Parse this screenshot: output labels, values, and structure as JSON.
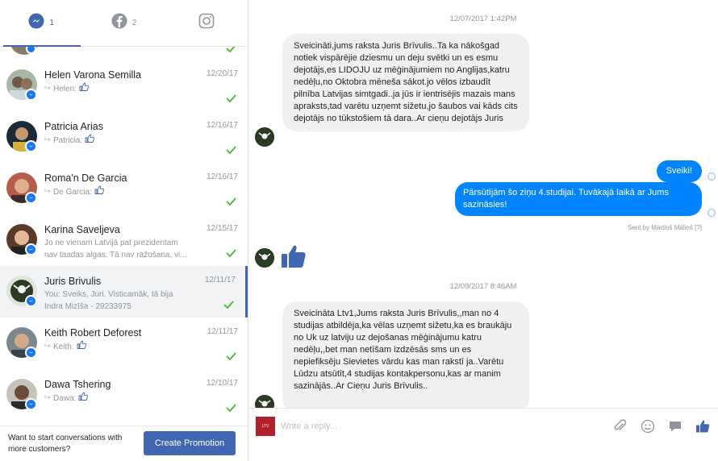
{
  "tabs": {
    "messenger_count": "1",
    "facebook_count": "2"
  },
  "conversations": [
    {
      "name": "Helen Varona Semilla",
      "date": "12/20/17",
      "snippet": "Helen:"
    },
    {
      "name": "Patricia Arias",
      "date": "12/16/17",
      "snippet": "Patricia:"
    },
    {
      "name": "Roma'n De Garcia",
      "date": "12/16/17",
      "snippet": "De Garcia:"
    },
    {
      "name": "Karina Saveljeva",
      "date": "12/15/17",
      "snippet_line1": "Jo ne vienam Latvijā pat prezidentam",
      "snippet_line2": "nav taadas algas. Tā nav ražošana, vi..."
    },
    {
      "name": "Juris Brivulis",
      "date": "12/11/17",
      "snippet_line1": "You: Sveiks, Juri. Visticamāk, tā bija",
      "snippet_line2": "Indra Mizīša - 29233975"
    },
    {
      "name": "Keith Robert Deforest",
      "date": "12/11/17",
      "snippet": "Keith:"
    },
    {
      "name": "Dawa Tshering",
      "date": "12/10/17",
      "snippet": "Dawa:"
    }
  ],
  "promo": {
    "text": "Want to start conversations with more customers?",
    "button": "Create Promotion"
  },
  "thread": {
    "timestamp1": "12/07/2017 1:42PM",
    "message1": "Sveicināti,jums raksta Juris Brīvulis..Ta ka nākošgad notiek vispārējie dziesmu un deju svētki un es esmu dejotājs,es LIDOJU uz mēģinājumiem no Anglijas,katru nedēļu,no Oktobra mēneša sākot.jo vēlos izbaudīt pilnība Latvijas simtgadi..ja jūs ir ientrisējis mazais mans apraksts,tad varētu uzņemt sižetu,jo šaubos vai kāds cits dejotājs no tūkstošiem tā dara..Ar cieņu dejotājs Juris",
    "reply1": "Sveiki!",
    "reply2": "Pārsūtījām šo ziņu 4.studijai. Tuvākajā laikā ar Jums sazināsies!",
    "sent_by": "Sent by Mārtiņš Māliņš [?]",
    "timestamp2": "12/09/2017 8:46AM",
    "message2": "Sveicināta Ltv1,Jums raksta Juris Brīvulis,,man no 4 studijas atbildēja,ka vēlas uzņemt sižetu,ka es braukāju no Uk uz latviju uz dejošanas mēģinājumu katru nedēļu,,bet man netīšam izdzēsās sms un es nepiefiksēju Sievietes vārdu kas man rakstī ja..Varētu Lūdzu atsūtīt,4 studijas kontakpersonu,kas ar manim sazinājās..Ar Cieņu Juris Brīvulis.."
  },
  "composer": {
    "placeholder": "Write a reply...",
    "page_label": "LTV"
  },
  "colors": {
    "accent": "#4267b2",
    "outgoing_bubble": "#0084ff",
    "incoming_bubble": "#f1f0f0",
    "check_green": "#42b72a"
  }
}
